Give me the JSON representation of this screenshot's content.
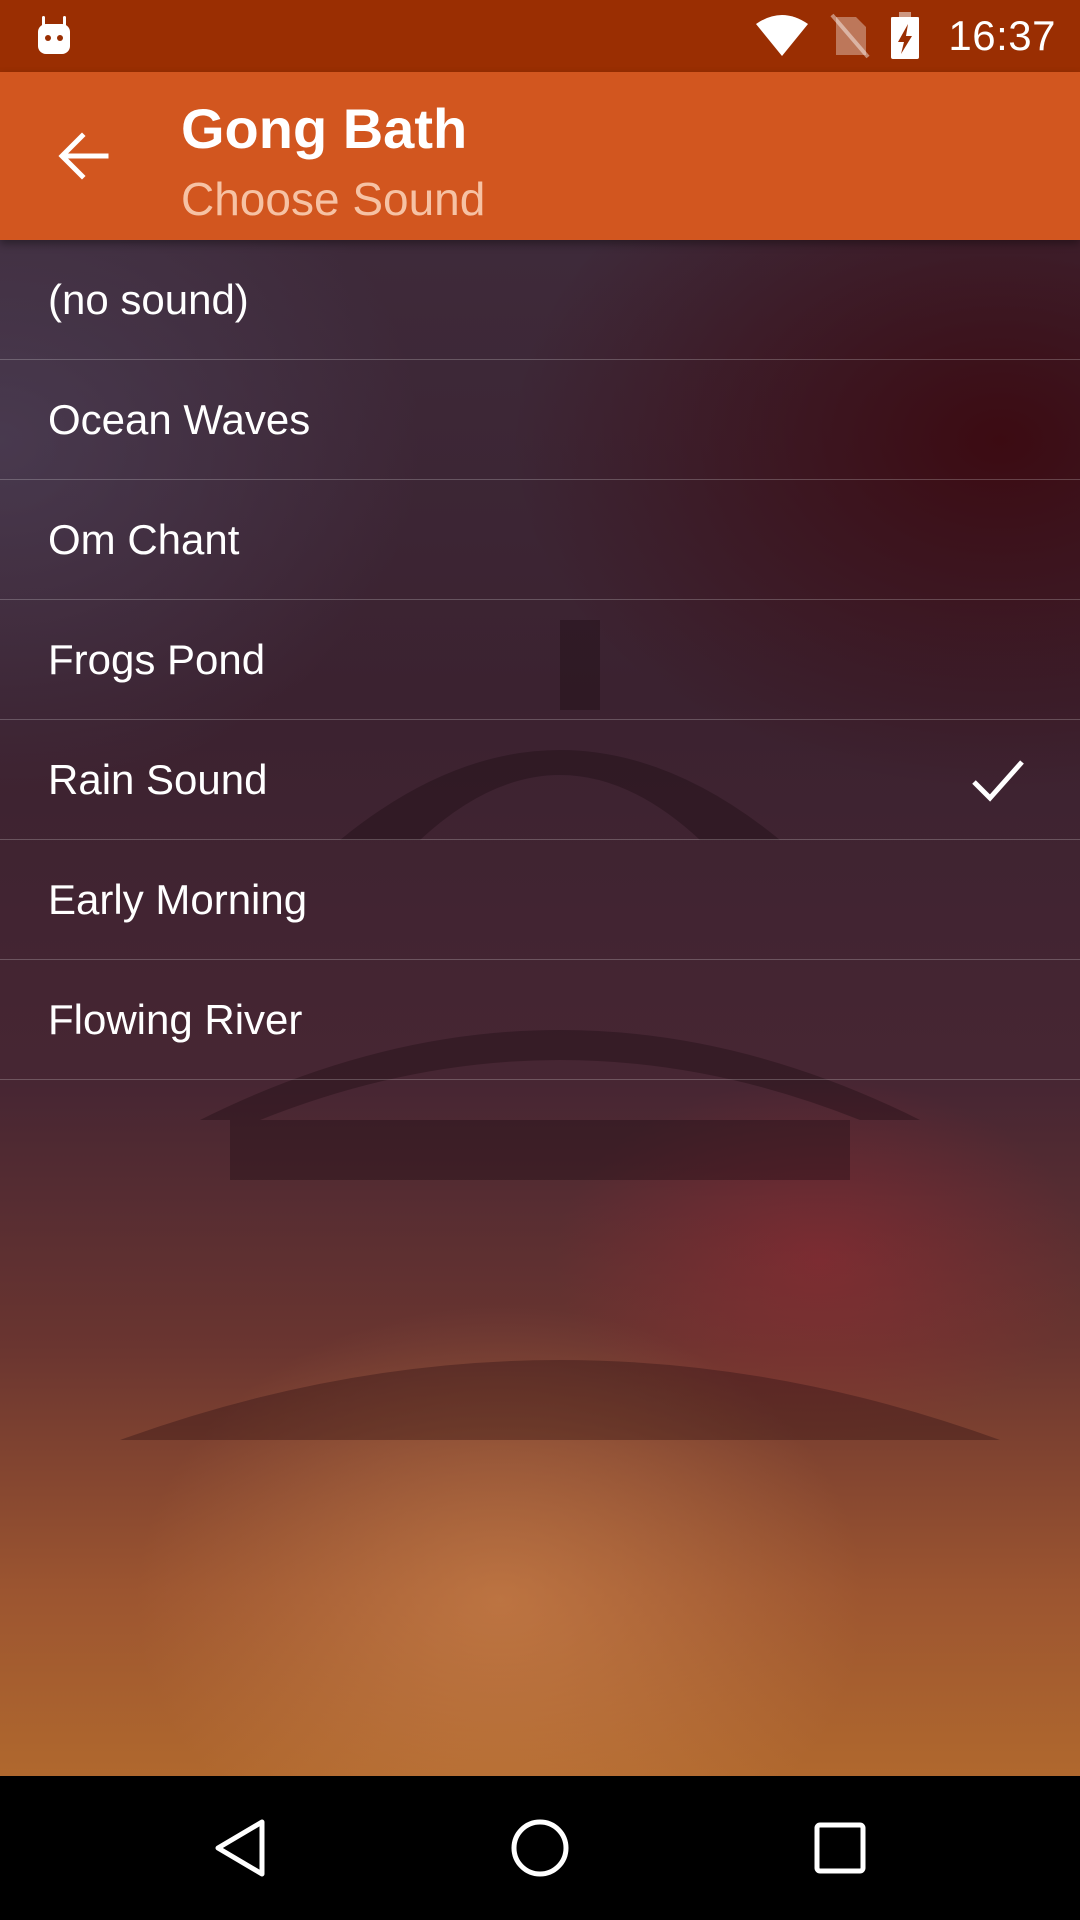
{
  "status_bar": {
    "time": "16:37",
    "icons": [
      "android-notification-icon",
      "wifi-icon",
      "no-sim-icon",
      "battery-charging-icon"
    ]
  },
  "app_bar": {
    "title": "Gong Bath",
    "subtitle": "Choose Sound",
    "back_icon": "arrow-back-icon"
  },
  "sound_list": {
    "items": [
      {
        "label": "(no sound)",
        "selected": false
      },
      {
        "label": "Ocean Waves",
        "selected": false
      },
      {
        "label": "Om Chant",
        "selected": false
      },
      {
        "label": "Frogs Pond",
        "selected": false
      },
      {
        "label": "Rain Sound",
        "selected": true
      },
      {
        "label": "Early Morning",
        "selected": false
      },
      {
        "label": "Flowing River",
        "selected": false
      }
    ]
  },
  "nav_bar": {
    "icons": [
      "back-triangle-icon",
      "home-circle-icon",
      "recents-square-icon"
    ]
  },
  "colors": {
    "status_bar": "#9a2e02",
    "app_bar": "#d2561f",
    "subtitle": "#f6c2a4",
    "nav_bar": "#000000"
  }
}
